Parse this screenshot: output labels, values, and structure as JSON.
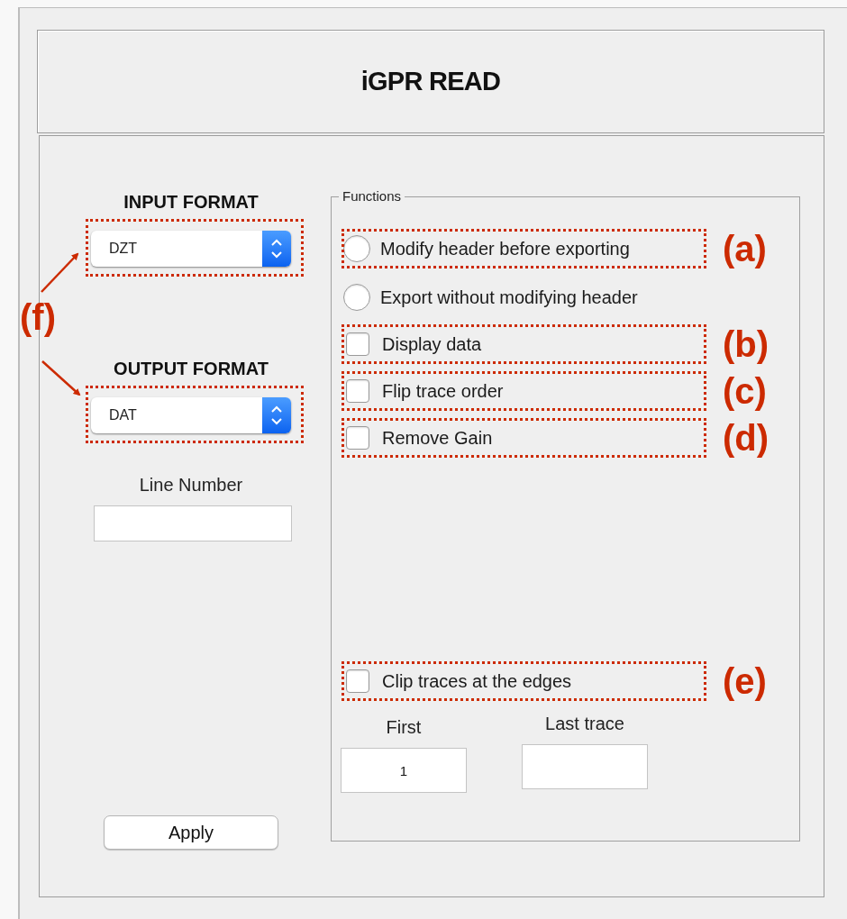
{
  "title": "iGPR READ",
  "input_format": {
    "label": "INPUT FORMAT",
    "value": "DZT"
  },
  "output_format": {
    "label": "OUTPUT FORMAT",
    "value": "DAT"
  },
  "format_annotation": "(f)",
  "line_number": {
    "label": "Line Number"
  },
  "apply_button": "Apply",
  "functions": {
    "title": "Functions",
    "options": [
      {
        "kind": "radio",
        "label": "Modify header before exporting",
        "selected": false,
        "annotation": "(a)"
      },
      {
        "kind": "radio",
        "label": "Export without modifying header",
        "selected": false
      },
      {
        "kind": "checkbox",
        "label": "Display data",
        "checked": false,
        "annotation": "(b)"
      },
      {
        "kind": "checkbox",
        "label": "Flip trace order",
        "checked": false,
        "annotation": "(c)"
      },
      {
        "kind": "checkbox",
        "label": "Remove Gain",
        "checked": false,
        "annotation": "(d)"
      }
    ],
    "clip": {
      "kind": "checkbox",
      "label": "Clip traces at the edges",
      "checked": false,
      "annotation": "(e)"
    },
    "first": {
      "label": "First",
      "value": "1"
    },
    "last_trace": {
      "label": "Last trace"
    }
  }
}
